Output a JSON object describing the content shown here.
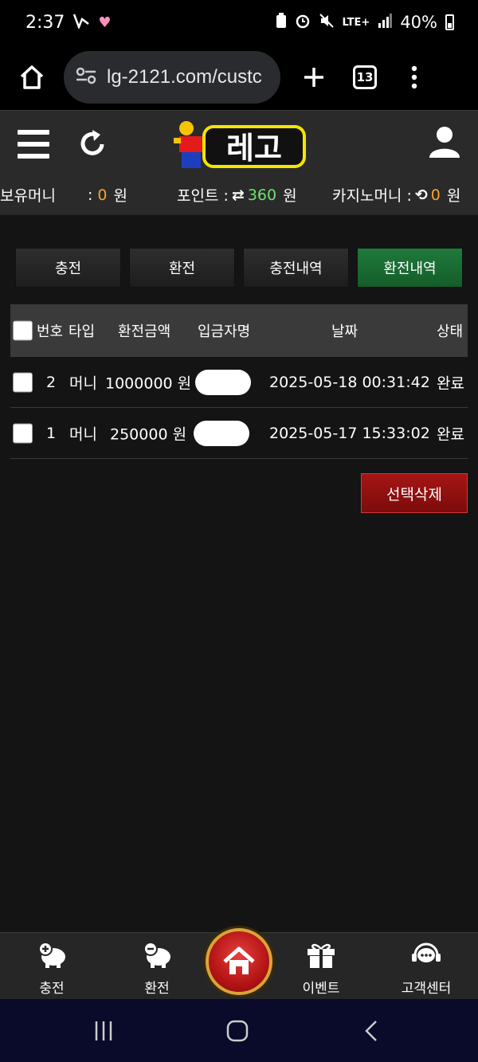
{
  "status_bar": {
    "time": "2:37",
    "carrier_badge": "LTE+",
    "battery": "40%"
  },
  "browser": {
    "url": "lg-2121.com/custc",
    "tab_count": "13"
  },
  "header": {
    "logo_text": "레고"
  },
  "balances": {
    "money_label": "보유머니",
    "money_value": "0",
    "money_unit": "원",
    "point_label": "포인트 :",
    "point_value": "360",
    "point_unit": "원",
    "casino_label": "카지노머니 :",
    "casino_value": "0",
    "casino_unit": "원",
    "colon": ":"
  },
  "tabs": [
    {
      "label": "충전",
      "active": false
    },
    {
      "label": "환전",
      "active": false
    },
    {
      "label": "충전내역",
      "active": false
    },
    {
      "label": "환전내역",
      "active": true
    }
  ],
  "table": {
    "headers": {
      "no": "번호",
      "type": "타입",
      "amount": "환전금액",
      "depositor": "입금자명",
      "date": "날짜",
      "status": "상태"
    },
    "rows": [
      {
        "no": "2",
        "type": "머니",
        "amount": "1000000 원",
        "date": "2025-05-18 00:31:42",
        "status": "완료"
      },
      {
        "no": "1",
        "type": "머니",
        "amount": "250000 원",
        "date": "2025-05-17 15:33:02",
        "status": "완료"
      }
    ]
  },
  "delete_button": "선택삭제",
  "bottom_nav": {
    "charge": "충전",
    "exchange": "환전",
    "event": "이벤트",
    "support": "고객센터"
  },
  "colors": {
    "accent_orange": "#f6a32a",
    "accent_green": "#6fe26f",
    "active_tab": "#1f7a3a",
    "delete_red": "#a51515"
  }
}
